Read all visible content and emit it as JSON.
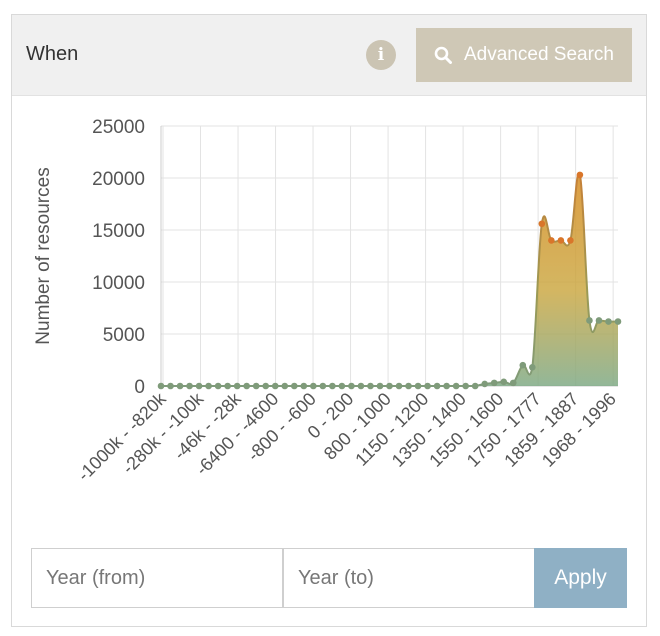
{
  "panel": {
    "title": "When",
    "info_icon": "info-icon",
    "advanced_search_label": "Advanced Search",
    "search_icon": "search-icon"
  },
  "filters": {
    "year_from_placeholder": "Year (from)",
    "year_to_placeholder": "Year (to)",
    "apply_label": "Apply"
  },
  "chart_data": {
    "type": "area",
    "ylabel": "Number of resources",
    "xlabel": "",
    "ylim": [
      0,
      25000
    ],
    "yticks": [
      0,
      5000,
      10000,
      15000,
      20000,
      25000
    ],
    "grid": true,
    "tick_labels": [
      "-1000k - -820k",
      "-280k - -100k",
      "-46k - -28k",
      "-6400 - -4600",
      "-800 - -600",
      "0 - 200",
      "800 - 1000",
      "1150 - 1200",
      "1350 - 1400",
      "1550 - 1600",
      "1750 - 1777",
      "1859 - 1887",
      "1968 - 1996"
    ],
    "values": [
      0,
      0,
      0,
      0,
      0,
      0,
      0,
      0,
      0,
      0,
      0,
      0,
      0,
      0,
      0,
      0,
      0,
      0,
      0,
      0,
      0,
      0,
      0,
      0,
      0,
      0,
      0,
      0,
      0,
      0,
      0,
      0,
      0,
      0,
      200,
      300,
      400,
      300,
      2000,
      1800,
      15600,
      14000,
      14000,
      14000,
      20300,
      6300,
      6300,
      6200,
      6200
    ],
    "colors": {
      "line_low": "#7f9b7a",
      "line_high": "#d9762a",
      "fill_high": "#d9922e",
      "fill_mid": "#c9a43a",
      "fill_low": "#7faa86",
      "grid": "#e3e3e3",
      "axis": "#cccccc"
    }
  }
}
